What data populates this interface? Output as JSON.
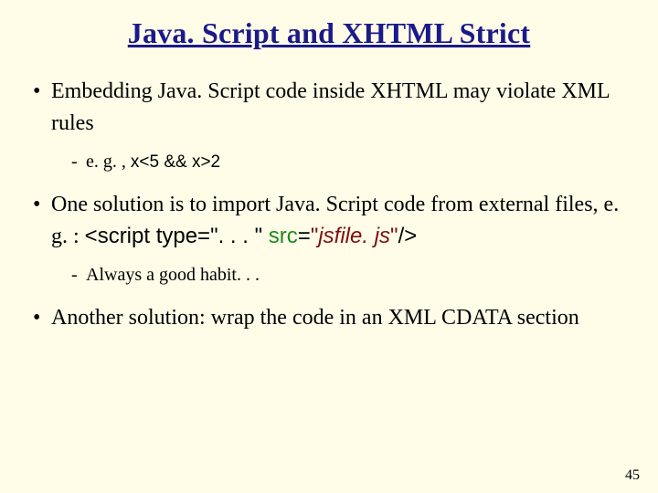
{
  "title": "Java. Script and XHTML Strict",
  "bullets": {
    "b1": {
      "text": "Embedding Java. Script code inside XHTML may violate XML rules",
      "sub": {
        "prefix": "e. g. , ",
        "code": "x<5 && x>2"
      }
    },
    "b2": {
      "lead": "One solution is to import Java. Script code from external files, e. g. : ",
      "tag_open": "<script type=\". . . \" ",
      "src_attr": "src",
      "src_eq": "=",
      "src_q1": "\"",
      "src_val": "jsfile. js",
      "src_q2": "\"",
      "tag_close": "/>",
      "sub": "Always a good habit. . ."
    },
    "b3": {
      "text": "Another solution: wrap the code in an XML CDATA section"
    }
  },
  "page_number": "45"
}
